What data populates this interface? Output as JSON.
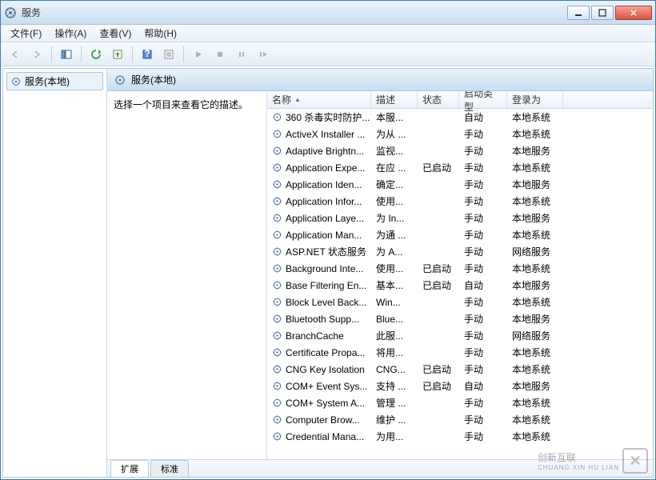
{
  "window": {
    "title": "服务"
  },
  "menu": {
    "file": "文件(F)",
    "action": "操作(A)",
    "view": "查看(V)",
    "help": "帮助(H)"
  },
  "tree": {
    "root": "服务(本地)"
  },
  "panel": {
    "header": "服务(本地)",
    "hint": "选择一个项目来查看它的描述。"
  },
  "columns": {
    "name": "名称",
    "desc": "描述",
    "status": "状态",
    "startup": "启动类型",
    "logon": "登录为"
  },
  "tabs": {
    "extended": "扩展",
    "standard": "标准"
  },
  "services": [
    {
      "name": "360 杀毒实时防护...",
      "desc": "本服...",
      "status": "",
      "startup": "自动",
      "logon": "本地系统"
    },
    {
      "name": "ActiveX Installer ...",
      "desc": "为从 ...",
      "status": "",
      "startup": "手动",
      "logon": "本地系统"
    },
    {
      "name": "Adaptive Brightn...",
      "desc": "监视...",
      "status": "",
      "startup": "手动",
      "logon": "本地服务"
    },
    {
      "name": "Application Expe...",
      "desc": "在应 ...",
      "status": "已启动",
      "startup": "手动",
      "logon": "本地系统"
    },
    {
      "name": "Application Iden...",
      "desc": "确定...",
      "status": "",
      "startup": "手动",
      "logon": "本地服务"
    },
    {
      "name": "Application Infor...",
      "desc": "使用...",
      "status": "",
      "startup": "手动",
      "logon": "本地系统"
    },
    {
      "name": "Application Laye...",
      "desc": "为 In...",
      "status": "",
      "startup": "手动",
      "logon": "本地服务"
    },
    {
      "name": "Application Man...",
      "desc": "为通 ...",
      "status": "",
      "startup": "手动",
      "logon": "本地系统"
    },
    {
      "name": "ASP.NET 状态服务",
      "desc": "为 A...",
      "status": "",
      "startup": "手动",
      "logon": "网络服务"
    },
    {
      "name": "Background Inte...",
      "desc": "使用...",
      "status": "已启动",
      "startup": "手动",
      "logon": "本地系统"
    },
    {
      "name": "Base Filtering En...",
      "desc": "基本...",
      "status": "已启动",
      "startup": "自动",
      "logon": "本地服务"
    },
    {
      "name": "Block Level Back...",
      "desc": "Win...",
      "status": "",
      "startup": "手动",
      "logon": "本地系统"
    },
    {
      "name": "Bluetooth Supp...",
      "desc": "Blue...",
      "status": "",
      "startup": "手动",
      "logon": "本地服务"
    },
    {
      "name": "BranchCache",
      "desc": "此服...",
      "status": "",
      "startup": "手动",
      "logon": "网络服务"
    },
    {
      "name": "Certificate Propa...",
      "desc": "将用...",
      "status": "",
      "startup": "手动",
      "logon": "本地系统"
    },
    {
      "name": "CNG Key Isolation",
      "desc": "CNG...",
      "status": "已启动",
      "startup": "手动",
      "logon": "本地系统"
    },
    {
      "name": "COM+ Event Sys...",
      "desc": "支持 ...",
      "status": "已启动",
      "startup": "自动",
      "logon": "本地服务"
    },
    {
      "name": "COM+ System A...",
      "desc": "管理 ...",
      "status": "",
      "startup": "手动",
      "logon": "本地系统"
    },
    {
      "name": "Computer Brow...",
      "desc": "维护 ...",
      "status": "",
      "startup": "手动",
      "logon": "本地系统"
    },
    {
      "name": "Credential Mana...",
      "desc": "为用...",
      "status": "",
      "startup": "手动",
      "logon": "本地系统"
    }
  ],
  "watermark": {
    "brand": "创新互联",
    "sub": "CHUANG XIN HU LIAN"
  }
}
